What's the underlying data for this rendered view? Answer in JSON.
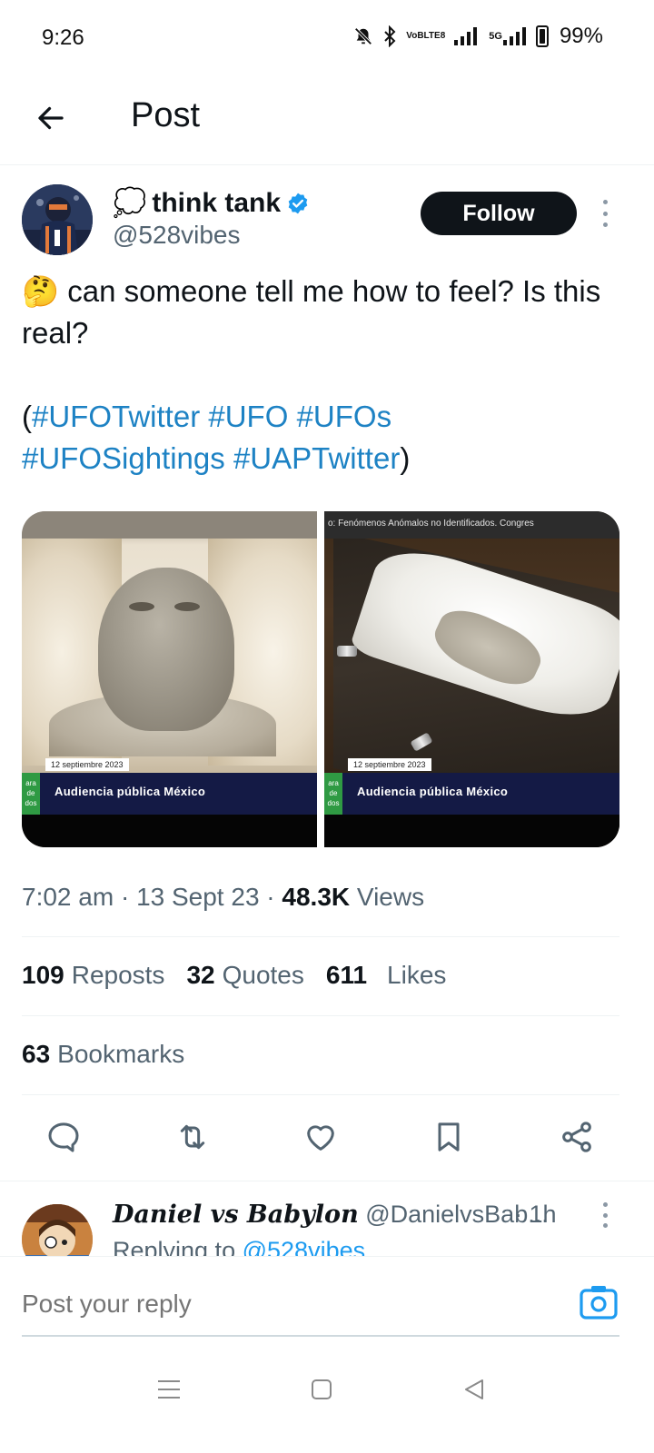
{
  "status_bar": {
    "time": "9:26",
    "volte_top": "VoB",
    "volte_bottom": "LTE8",
    "network": "5G",
    "battery": "99%"
  },
  "header": {
    "title": "Post",
    "back_icon": "arrow-left-icon"
  },
  "post": {
    "display_name_emoji": "💭",
    "display_name": "think tank",
    "verified": true,
    "handle": "@528vibes",
    "follow_label": "Follow",
    "text_emoji": "🤔",
    "text": "can someone tell me how to feel? Is this real?",
    "hashtags_open": "(",
    "hashtags": [
      "#UFOTwitter",
      "#UFO",
      "#UFOs",
      "#UFOSightings",
      "#UAPTwitter"
    ],
    "hashtags_close": ")",
    "media": [
      {
        "top_caption": "",
        "date": "12 septiembre 2023",
        "side_label": "ara de dos",
        "lower_text": "Audiencia pública México"
      },
      {
        "top_caption": "o: Fenómenos Anómalos no Identificados. Congres",
        "date": "12 septiembre 2023",
        "side_label": "ara de dos",
        "lower_text": "Audiencia pública México"
      }
    ],
    "time": "7:02 am",
    "date": "13 Sept 23",
    "views_count": "48.3K",
    "views_label": "Views",
    "reposts_count": "109",
    "reposts_label": "Reposts",
    "quotes_count": "32",
    "quotes_label": "Quotes",
    "likes_count": "611",
    "likes_label": "Likes",
    "bookmarks_count": "63",
    "bookmarks_label": "Bookmarks"
  },
  "actions": [
    "reply-icon",
    "repost-icon",
    "like-icon",
    "bookmark-icon",
    "share-icon"
  ],
  "reply": {
    "display_name": "Daniel vs Babylon",
    "handle": "@DanielvsBab...",
    "time": "· 1h",
    "replying_prefix": "Replying to",
    "replying_to": "@528vibes"
  },
  "composer": {
    "placeholder": "Post your reply"
  },
  "colors": {
    "accent": "#1d9bf0",
    "text": "#0f1419",
    "secondary": "#536471",
    "follow_bg": "#0f1419"
  }
}
